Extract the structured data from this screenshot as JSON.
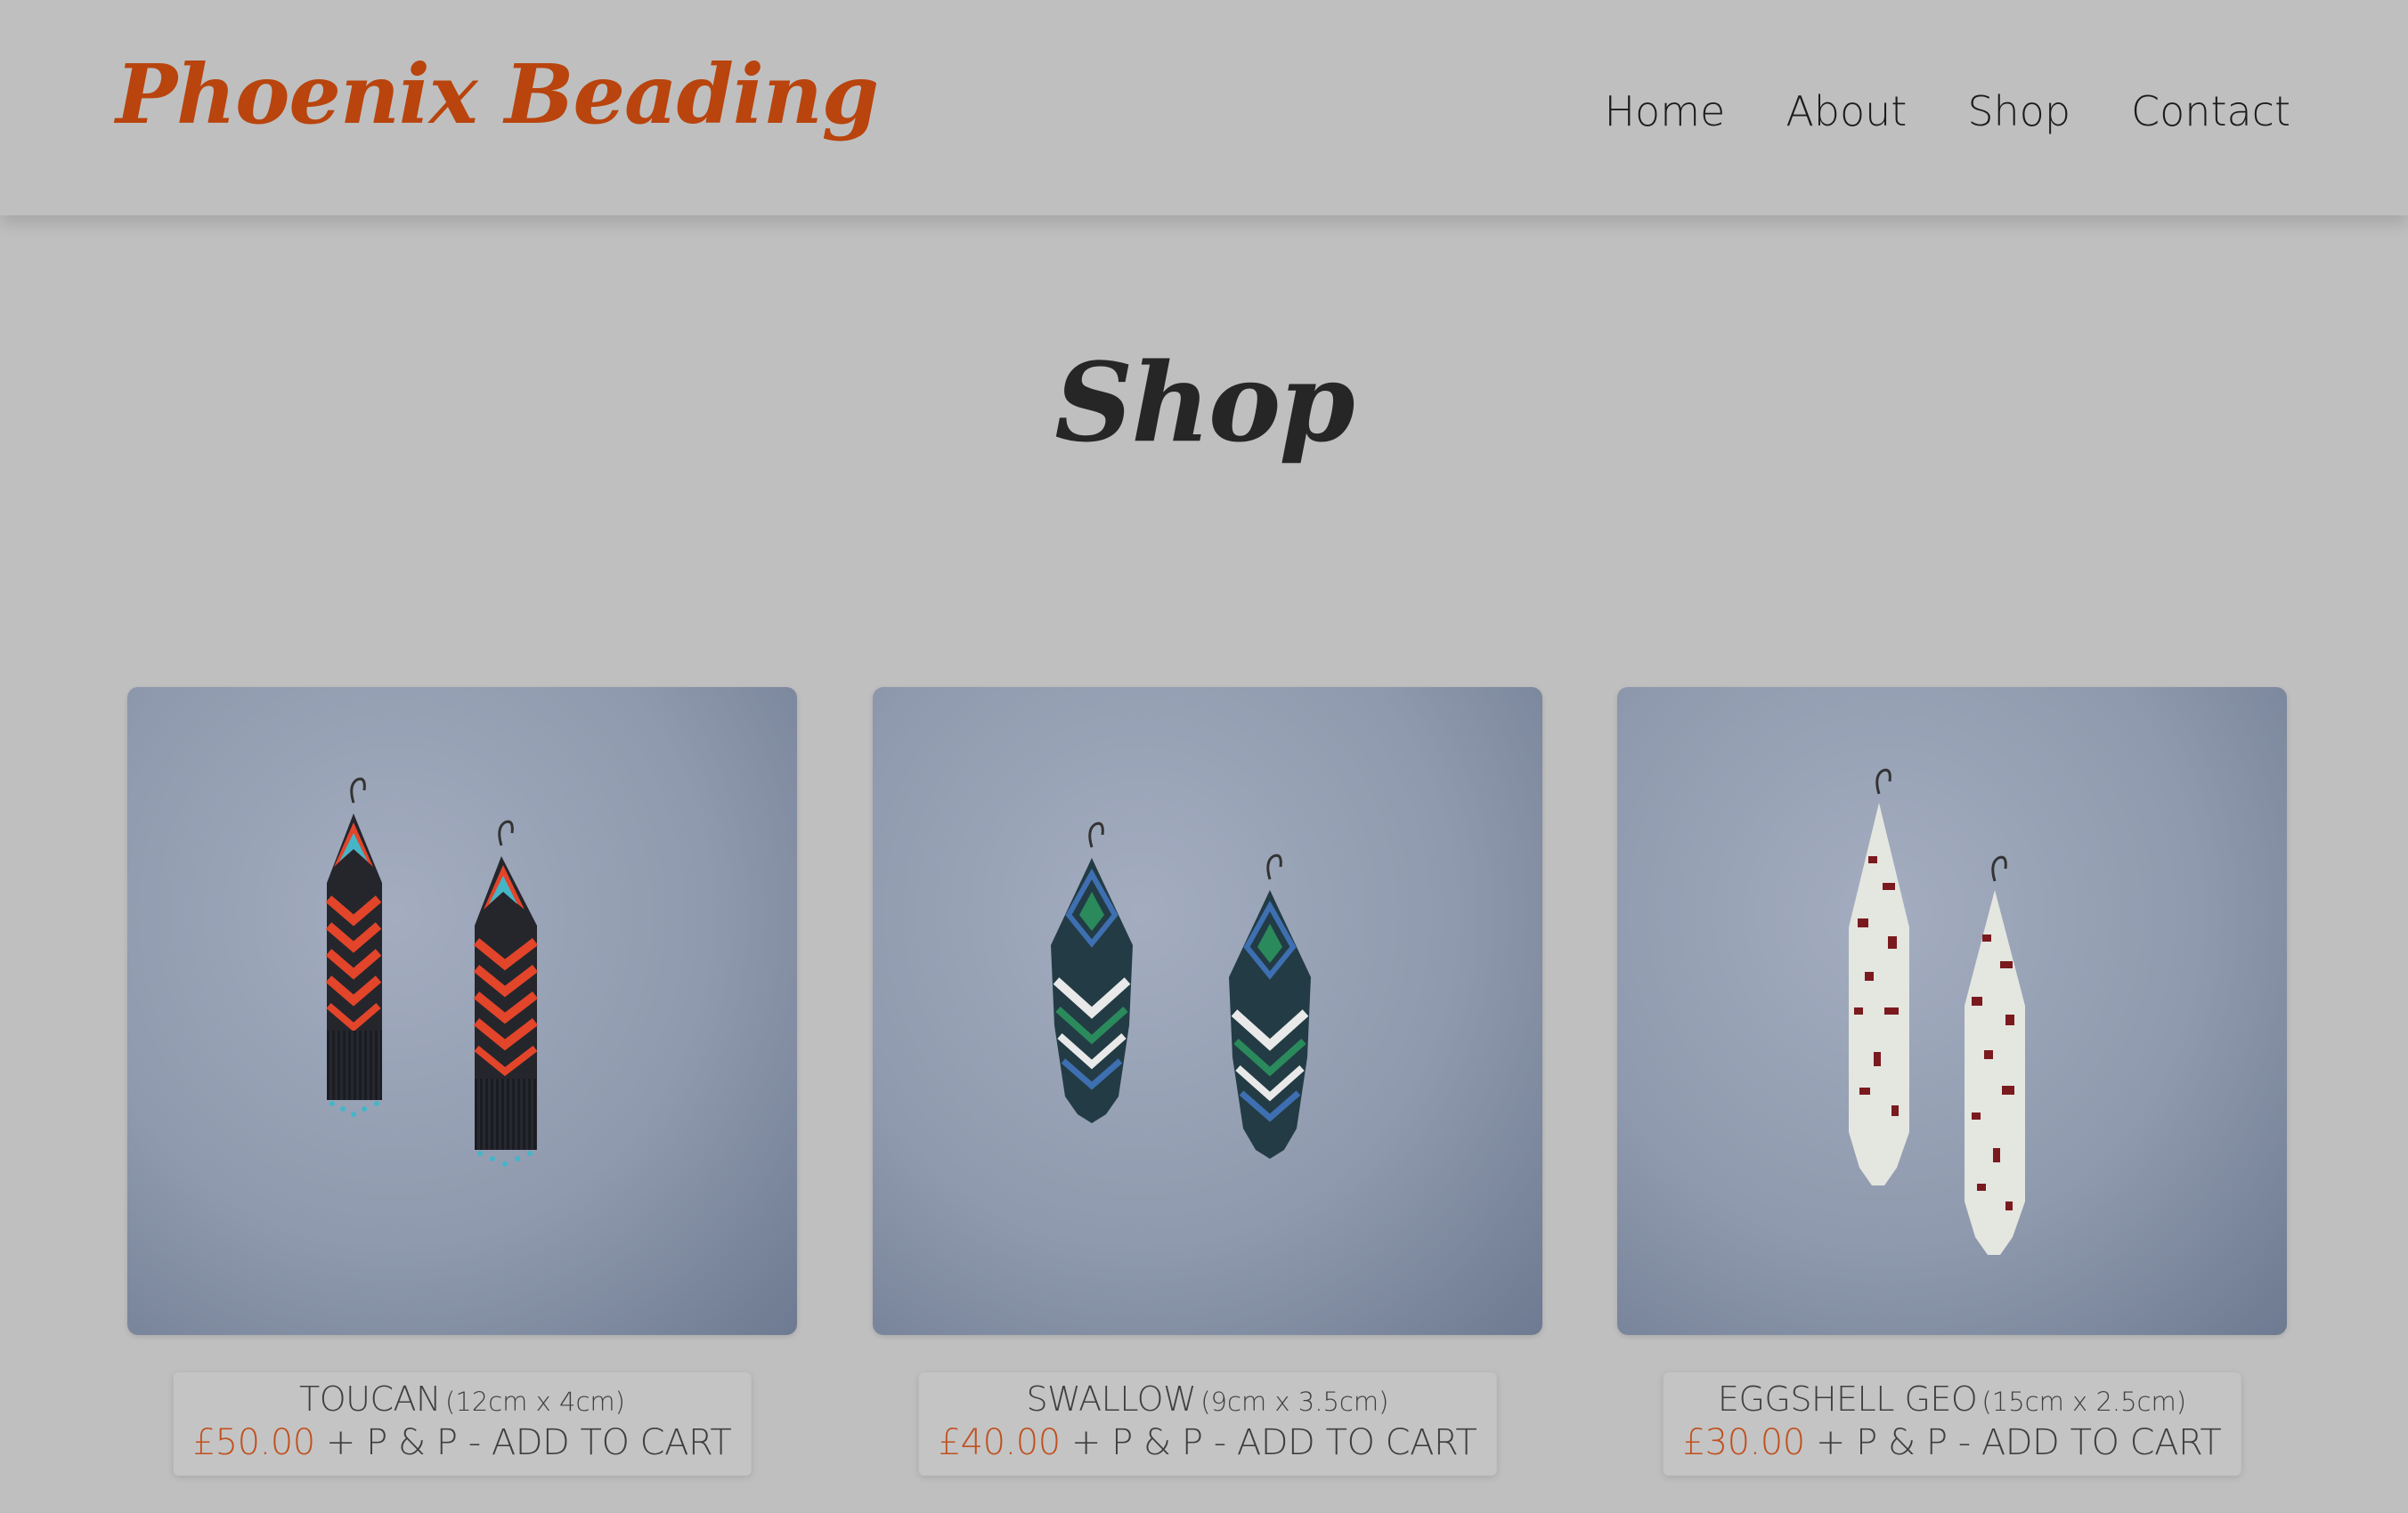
{
  "header": {
    "brand": "Phoenix Beading",
    "nav": [
      {
        "label": "Home"
      },
      {
        "label": "About"
      },
      {
        "label": "Shop"
      },
      {
        "label": "Contact"
      }
    ]
  },
  "page": {
    "title": "Shop"
  },
  "products": [
    {
      "name": "TOUCAN",
      "size": "(12cm x 4cm)",
      "price": "£50.00",
      "suffix": "+ P & P -",
      "cta": "ADD TO CART",
      "image_icon": "beaded-fringe-earrings-black-orange-turquoise"
    },
    {
      "name": "SWALLOW",
      "size": "(9cm x 3.5cm)",
      "price": "£40.00",
      "suffix": "+ P & P -",
      "cta": "ADD TO CART",
      "image_icon": "beaded-fringe-earrings-green-blue-white"
    },
    {
      "name": "EGGSHELL GEO",
      "size": "(15cm x 2.5cm)",
      "price": "£30.00",
      "suffix": "+ P & P -",
      "cta": "ADD TO CART",
      "image_icon": "beaded-fringe-earrings-white-burgundy"
    }
  ],
  "colors": {
    "background": "#bfbfbf",
    "brand": "#b9440d",
    "price": "#c0501e",
    "text": "#222222"
  }
}
